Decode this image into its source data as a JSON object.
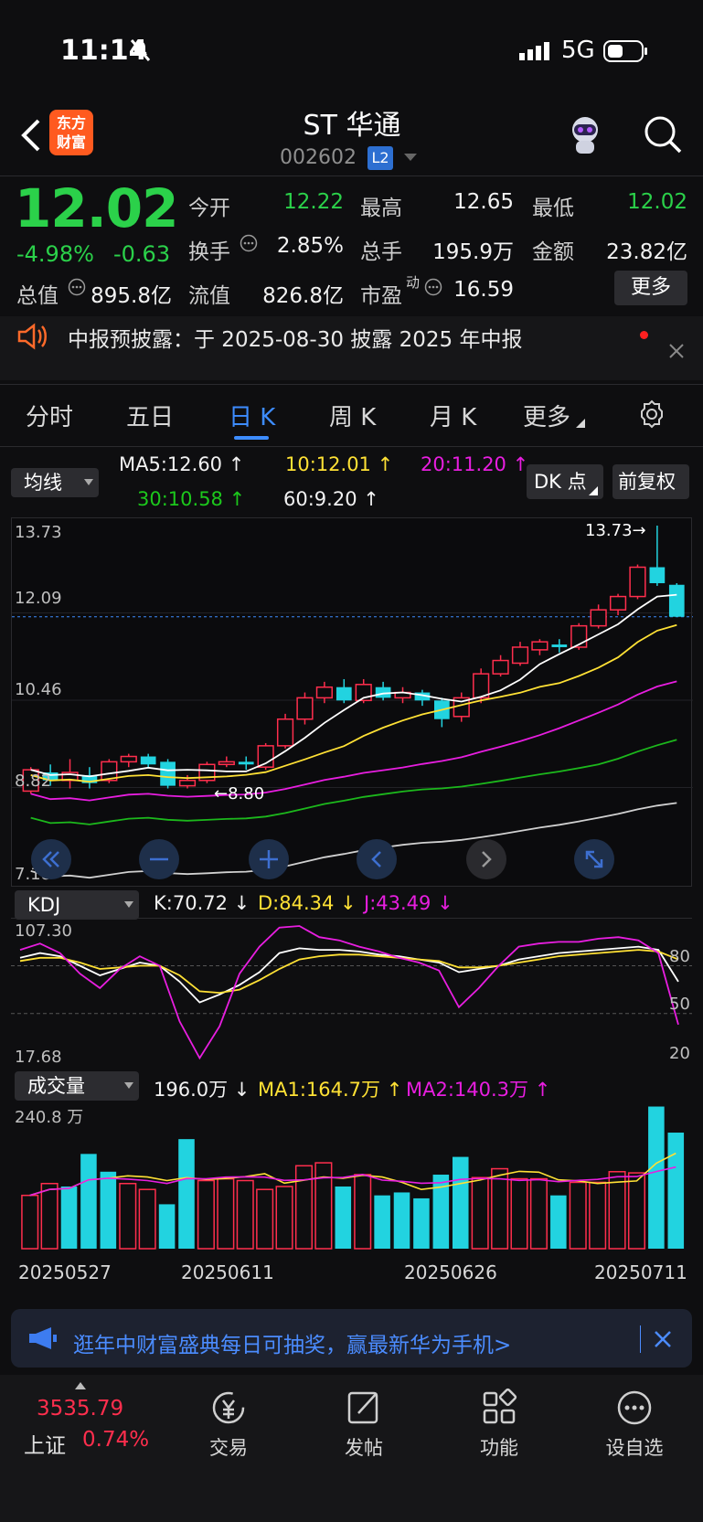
{
  "status": {
    "time": "11:14",
    "network": "5G"
  },
  "header": {
    "logo_line1": "东方",
    "logo_line2": "财富",
    "name": "ST 华通",
    "code": "002602",
    "level_badge": "L2"
  },
  "quote": {
    "price": "12.02",
    "change_pct": "-4.98%",
    "change": "-0.63",
    "rows": [
      [
        {
          "label": "今开",
          "value": "12.22",
          "color": "green"
        },
        {
          "label": "最高",
          "value": "12.65",
          "color": "white"
        },
        {
          "label": "最低",
          "value": "12.02",
          "color": "green"
        }
      ],
      [
        {
          "label": "换手",
          "value": "2.85%",
          "color": "white"
        },
        {
          "label": "总手",
          "value": "195.9万",
          "color": "white"
        },
        {
          "label": "金额",
          "value": "23.82亿",
          "color": "white"
        }
      ],
      [
        {
          "label": "总值",
          "value": "895.8亿",
          "color": "white"
        },
        {
          "label": "流值",
          "value": "826.8亿",
          "color": "white"
        },
        {
          "label": "市盈",
          "sup": "动",
          "value": "16.59",
          "color": "white"
        }
      ]
    ],
    "more_label": "更多"
  },
  "notice": {
    "text": "中报预披露：于 2025-08-30 披露 2025 年中报"
  },
  "tabs": [
    {
      "label": "分时",
      "active": false
    },
    {
      "label": "五日",
      "active": false
    },
    {
      "label": "日 K",
      "active": true
    },
    {
      "label": "周 K",
      "active": false
    },
    {
      "label": "月 K",
      "active": false
    },
    {
      "label": "更多",
      "active": false
    }
  ],
  "ma_row": {
    "selector": "均线",
    "ma5": "MA5:12.60 ↑",
    "ma10": "10:12.01 ↑",
    "ma20": "20:11.20 ↑",
    "ma30": "30:10.58 ↑",
    "ma60": "60:9.20 ↑",
    "dk_button": "DK 点",
    "adjust_button": "前复权"
  },
  "colors": {
    "up": "#ff2e4d",
    "down": "#22d3e0",
    "ma5": "#ffffff",
    "ma10": "#ffe135",
    "ma20": "#e81ee0",
    "ma30": "#1cb81c",
    "ma60": "#d0d0d0",
    "accent": "#3d8cff"
  },
  "chart_data": [
    {
      "type": "candlestick",
      "y_axis_labels": [
        "13.73",
        "12.09",
        "10.46",
        "8.82",
        "7.18"
      ],
      "ylim": [
        7.18,
        13.73
      ],
      "annotations": {
        "high": "13.73→",
        "low": "←8.80"
      },
      "last_price_line": 12.02,
      "x_dates": [
        "20250527",
        "20250611",
        "20250626",
        "20250711"
      ],
      "candles": [
        [
          8.75,
          9.15,
          9.2,
          8.7
        ],
        [
          9.1,
          8.95,
          9.25,
          8.85
        ],
        [
          8.95,
          9.1,
          9.35,
          8.8
        ],
        [
          9.05,
          8.9,
          9.2,
          8.8
        ],
        [
          8.95,
          9.3,
          9.35,
          8.9
        ],
        [
          9.3,
          9.4,
          9.45,
          9.2
        ],
        [
          9.4,
          9.25,
          9.45,
          9.2
        ],
        [
          9.3,
          8.85,
          9.35,
          8.8
        ],
        [
          8.85,
          8.95,
          9.05,
          8.8
        ],
        [
          8.95,
          9.25,
          9.3,
          8.9
        ],
        [
          9.25,
          9.3,
          9.4,
          9.2
        ],
        [
          9.3,
          9.25,
          9.4,
          9.15
        ],
        [
          9.2,
          9.6,
          9.65,
          9.15
        ],
        [
          9.6,
          10.1,
          10.2,
          9.55
        ],
        [
          10.1,
          10.5,
          10.6,
          10.0
        ],
        [
          10.5,
          10.7,
          10.8,
          10.4
        ],
        [
          10.7,
          10.45,
          10.85,
          10.4
        ],
        [
          10.45,
          10.75,
          10.85,
          10.4
        ],
        [
          10.7,
          10.5,
          10.8,
          10.45
        ],
        [
          10.5,
          10.6,
          10.7,
          10.4
        ],
        [
          10.6,
          10.45,
          10.65,
          10.35
        ],
        [
          10.45,
          10.1,
          10.5,
          9.95
        ],
        [
          10.15,
          10.5,
          10.6,
          10.05
        ],
        [
          10.5,
          10.95,
          11.05,
          10.4
        ],
        [
          10.95,
          11.2,
          11.3,
          10.9
        ],
        [
          11.15,
          11.45,
          11.55,
          11.1
        ],
        [
          11.4,
          11.55,
          11.6,
          11.3
        ],
        [
          11.5,
          11.45,
          11.6,
          11.35
        ],
        [
          11.45,
          11.85,
          11.9,
          11.4
        ],
        [
          11.85,
          12.15,
          12.25,
          11.8
        ],
        [
          12.15,
          12.4,
          12.45,
          12.05
        ],
        [
          12.4,
          12.95,
          13.0,
          12.35
        ],
        [
          12.95,
          12.65,
          13.73,
          12.6
        ],
        [
          12.62,
          12.02,
          12.65,
          12.02
        ]
      ]
    },
    {
      "type": "line",
      "title": "KDJ",
      "values_text": {
        "k": "K:70.72 ↓",
        "d": "D:84.34 ↓",
        "j": "J:43.49 ↓"
      },
      "y_axis_labels": [
        "107.30",
        "17.68",
        "80",
        "50",
        "20"
      ],
      "ylim": [
        17.68,
        107.3
      ],
      "series": [
        {
          "name": "K",
          "values": [
            85,
            88,
            86,
            80,
            74,
            78,
            82,
            80,
            70,
            57,
            62,
            68,
            76,
            88,
            91,
            90,
            90,
            89,
            87,
            86,
            84,
            82,
            76,
            78,
            80,
            84,
            86,
            88,
            89,
            90,
            91,
            92,
            90,
            70
          ]
        },
        {
          "name": "D",
          "values": [
            83,
            85,
            85,
            82,
            78,
            79,
            80,
            80,
            74,
            64,
            63,
            65,
            71,
            78,
            84,
            86,
            87,
            87,
            86,
            85,
            84,
            83,
            79,
            79,
            80,
            82,
            84,
            86,
            87,
            88,
            89,
            90,
            89,
            84
          ]
        },
        {
          "name": "J",
          "values": [
            90,
            94,
            88,
            75,
            66,
            78,
            86,
            80,
            45,
            22,
            42,
            75,
            92,
            104,
            105,
            98,
            96,
            92,
            89,
            85,
            82,
            77,
            54,
            66,
            80,
            92,
            94,
            95,
            95,
            97,
            98,
            96,
            88,
            43
          ]
        }
      ]
    },
    {
      "type": "bar",
      "title": "成交量",
      "values_text": {
        "vol": "196.0万 ↓",
        "ma1": "MA1:164.7万 ↑",
        "ma2": "MA2:140.3万 ↑"
      },
      "y_axis_labels": [
        "240.8 万"
      ],
      "ylim": [
        0,
        240.8
      ],
      "values": [
        90,
        110,
        105,
        160,
        130,
        110,
        100,
        75,
        185,
        115,
        118,
        115,
        100,
        105,
        140,
        145,
        105,
        125,
        90,
        95,
        85,
        125,
        155,
        120,
        135,
        118,
        118,
        90,
        112,
        112,
        130,
        128,
        240,
        196
      ],
      "up": [
        true,
        true,
        false,
        false,
        false,
        true,
        true,
        false,
        false,
        true,
        true,
        true,
        true,
        true,
        true,
        true,
        false,
        true,
        false,
        false,
        false,
        false,
        false,
        true,
        true,
        true,
        true,
        false,
        true,
        true,
        true,
        true,
        false,
        false
      ]
    }
  ],
  "kdj_selector": "KDJ",
  "vol_selector": "成交量",
  "banner": {
    "text": "逛年中财富盛典每日可抽奖，赢最新华为手机>"
  },
  "bottom_nav": {
    "index_value": "3535.79",
    "index_name": "上证",
    "index_pct": "0.74%",
    "items": [
      {
        "label": "交易"
      },
      {
        "label": "发帖"
      },
      {
        "label": "功能"
      },
      {
        "label": "设自选"
      }
    ]
  }
}
